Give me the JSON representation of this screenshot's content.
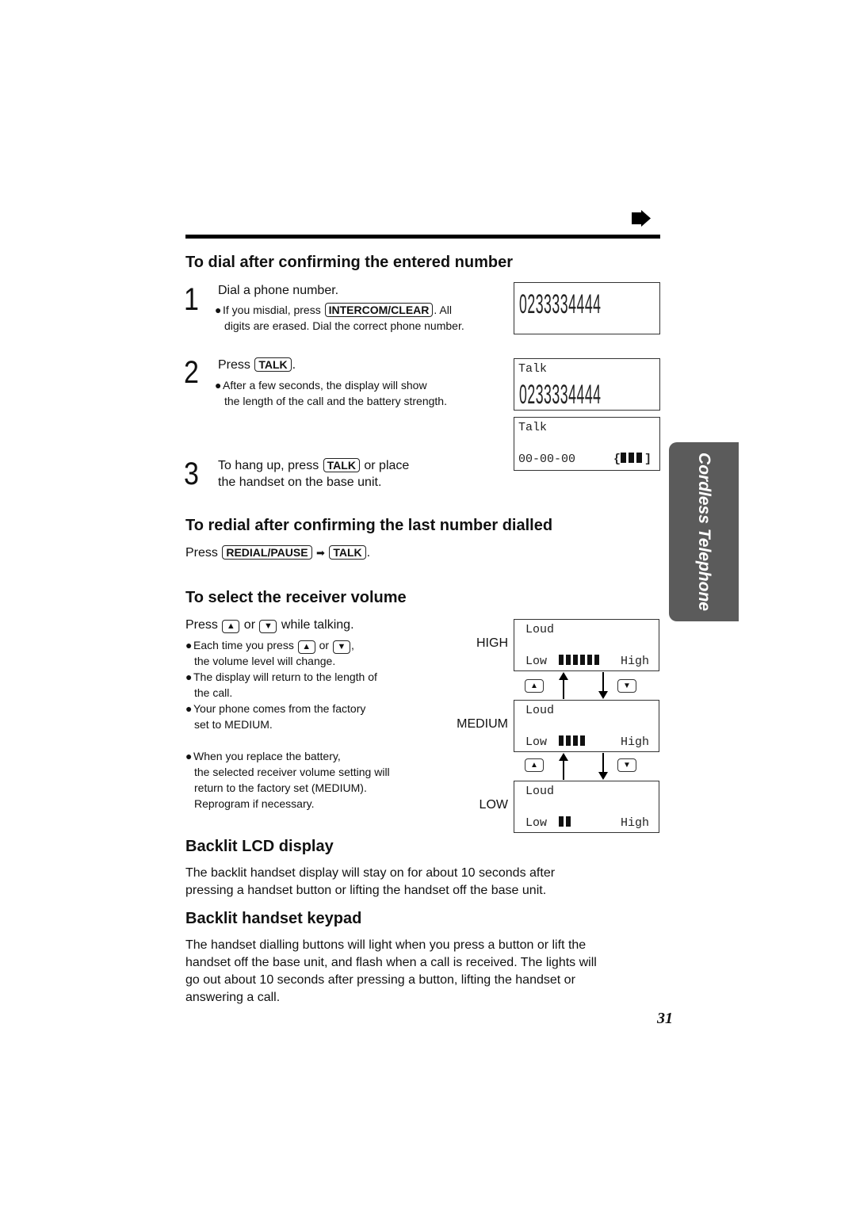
{
  "page": {
    "next_arrow_icon": "right-arrow",
    "page_number": "31",
    "side_tab": "Cordless Telephone"
  },
  "section_dial": {
    "title": "To dial after confirming the entered number",
    "steps": [
      {
        "number": "1",
        "text": "Dial a phone number.",
        "note_before": "If you misdial, press ",
        "note_key": "INTERCOM/CLEAR",
        "note_after": ". All",
        "note_line2": "digits are erased. Dial the correct phone number."
      },
      {
        "number": "2",
        "text_before": "Press ",
        "text_key": "TALK",
        "text_after": ".",
        "note_line1": "After a few seconds, the display will show",
        "note_line2": "the length of the call and the battery strength."
      },
      {
        "number": "3",
        "text_before": "To hang up, press ",
        "text_key": "TALK",
        "text_after": " or place",
        "text_line2": "the handset on the base unit."
      }
    ],
    "displays": [
      {
        "line1": "",
        "number": "0233334444"
      },
      {
        "line1": "Talk",
        "number": "0233334444"
      },
      {
        "line1": "Talk",
        "timer": "00-00-00",
        "battery_open": "{",
        "battery_close": "]",
        "battery_level": 3,
        "battery_max": 3
      }
    ]
  },
  "section_redial": {
    "title": "To redial after confirming the last number dialled",
    "press": "Press ",
    "key1": "REDIAL/PAUSE",
    "arrow": "➡",
    "key2": "TALK",
    "end": "."
  },
  "section_volume": {
    "title": "To select the receiver volume",
    "instruction_before": "Press ",
    "instruction_or": " or ",
    "instruction_after": " while talking.",
    "up_key": "▲",
    "down_key": "▼",
    "notes": {
      "n1_before": "Each time you press ",
      "n1_or": " or ",
      "n1_after": ",",
      "n1_line2": "the volume level will change.",
      "n2_line1": "The display will return to the length of",
      "n2_line2": "the call.",
      "n3_line1": "Your phone comes from the factory",
      "n3_line2": "set to MEDIUM.",
      "n4_line1": "When you replace the battery,",
      "n4_line2": "the selected receiver volume setting will",
      "n4_line3": "return to the factory set (MEDIUM).",
      "n4_line4": "Reprogram if necessary."
    },
    "levels": [
      {
        "label": "HIGH",
        "top": "Loud",
        "low": "Low",
        "high": "High",
        "bars": 6,
        "bars_max": 6
      },
      {
        "label": "MEDIUM",
        "top": "Loud",
        "low": "Low",
        "high": "High",
        "bars": 4,
        "bars_max": 6
      },
      {
        "label": "LOW",
        "top": "Loud",
        "low": "Low",
        "high": "High",
        "bars": 2,
        "bars_max": 6
      }
    ]
  },
  "section_lcd": {
    "title": "Backlit LCD display",
    "line1": "The backlit handset display will stay on for about 10 seconds after",
    "line2": "pressing a handset button or lifting the handset off the base unit."
  },
  "section_keypad": {
    "title": "Backlit handset keypad",
    "line1": "The handset dialling buttons will light when you press a button or lift the",
    "line2": "handset off the base unit, and flash when a call is received. The lights will",
    "line3": "go out about 10 seconds after pressing a button, lifting the handset or",
    "line4": "answering a call."
  }
}
